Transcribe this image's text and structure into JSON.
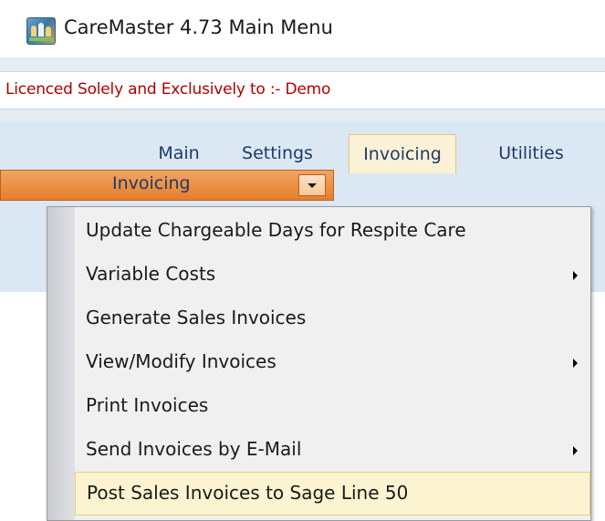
{
  "window": {
    "title": "CareMaster 4.73 Main Menu",
    "icon": "caremaster-app-icon"
  },
  "licence": {
    "text": "Licenced Solely and Exclusively to :-  Demo"
  },
  "ribbon": {
    "tabs": [
      {
        "label": "Main"
      },
      {
        "label": "Settings"
      },
      {
        "label": "Invoicing",
        "active": true
      },
      {
        "label": "Utilities"
      }
    ],
    "combo": {
      "label": "Invoicing",
      "icon": "chevron-down-icon"
    }
  },
  "menu": {
    "items": [
      {
        "label": "Update Chargeable Days for Respite Care",
        "submenu": false
      },
      {
        "label": "Variable Costs",
        "submenu": true
      },
      {
        "label": "Generate Sales Invoices",
        "submenu": false
      },
      {
        "label": "View/Modify Invoices",
        "submenu": true
      },
      {
        "label": "Print Invoices",
        "submenu": false
      },
      {
        "label": "Send Invoices by E-Mail",
        "submenu": true
      },
      {
        "label": "Post Sales Invoices to Sage Line 50",
        "submenu": false,
        "highlighted": true
      }
    ]
  },
  "colors": {
    "licence_text": "#b00000",
    "tab_text": "#1d3b66",
    "combo_orange": "#e88a3a",
    "highlight": "#fcf3d0"
  }
}
